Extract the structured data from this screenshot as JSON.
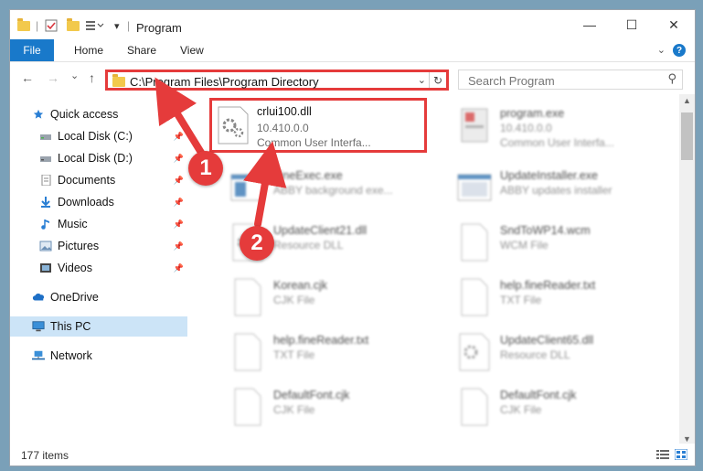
{
  "window": {
    "title": "Program",
    "controls": {
      "minimize": "—",
      "maximize": "☐",
      "close": "✕"
    }
  },
  "ribbon": {
    "tabs": [
      {
        "label": "File"
      },
      {
        "label": "Home"
      },
      {
        "label": "Share"
      },
      {
        "label": "View"
      }
    ]
  },
  "navbar": {
    "back": "←",
    "forward": "→",
    "recent": "⌄",
    "up": "↑",
    "address": "C:\\Program Files\\Program Directory",
    "search_placeholder": "Search Program"
  },
  "sidebar": {
    "items": [
      {
        "label": "Quick access",
        "icon": "star-icon",
        "pinned": false
      },
      {
        "label": "Local Disk (C:)",
        "icon": "drive-icon",
        "pinned": true
      },
      {
        "label": "Local Disk (D:)",
        "icon": "drive-icon",
        "pinned": true
      },
      {
        "label": "Documents",
        "icon": "documents-icon",
        "pinned": true
      },
      {
        "label": "Downloads",
        "icon": "downloads-icon",
        "pinned": true
      },
      {
        "label": "Music",
        "icon": "music-icon",
        "pinned": true
      },
      {
        "label": "Pictures",
        "icon": "pictures-icon",
        "pinned": true
      },
      {
        "label": "Videos",
        "icon": "videos-icon",
        "pinned": true
      },
      {
        "label": "OneDrive",
        "icon": "onedrive-icon",
        "pinned": false
      },
      {
        "label": "This PC",
        "icon": "computer-icon",
        "pinned": false,
        "selected": true
      },
      {
        "label": "Network",
        "icon": "network-icon",
        "pinned": false
      }
    ]
  },
  "files": [
    {
      "name": "crlui100.dll",
      "line2": "10.410.0.0",
      "line3": "Common User Interfa...",
      "icon": "dll-gear-icon",
      "highlight": true
    },
    {
      "name": "program.exe",
      "line2": "10.410.0.0",
      "line3": "Common User Interfa...",
      "icon": "exe-icon"
    },
    {
      "name": "FineExec.exe",
      "line2": "ABBY background exe...",
      "icon": "window-app-icon"
    },
    {
      "name": "UpdateInstaller.exe",
      "line2": "ABBY updates installer",
      "icon": "window-app-icon"
    },
    {
      "name": "UpdateClient21.dll",
      "line2": "Resource DLL",
      "icon": "dll-gear-icon"
    },
    {
      "name": "SndToWP14.wcm",
      "line2": "WCM File",
      "icon": "blank-file-icon"
    },
    {
      "name": "Korean.cjk",
      "line2": "CJK File",
      "icon": "blank-file-icon"
    },
    {
      "name": "help.fineReader.txt",
      "line2": "TXT File",
      "icon": "blank-file-icon"
    },
    {
      "name": "help.fineReader.txt",
      "line2": "TXT File",
      "icon": "blank-file-icon"
    },
    {
      "name": "UpdateClient65.dll",
      "line2": "Resource DLL",
      "icon": "dll-gear-icon"
    },
    {
      "name": "DefaultFont.cjk",
      "line2": "CJK File",
      "icon": "blank-file-icon"
    },
    {
      "name": "DefaultFont.cjk",
      "line2": "CJK File",
      "icon": "blank-file-icon"
    }
  ],
  "status": {
    "item_count": "177 items"
  },
  "callouts": [
    {
      "label": "1"
    },
    {
      "label": "2"
    }
  ],
  "colors": {
    "accent": "#1979ca",
    "highlight": "#e53b3b",
    "folder": "#f2c94c",
    "selected": "#cce4f7"
  }
}
